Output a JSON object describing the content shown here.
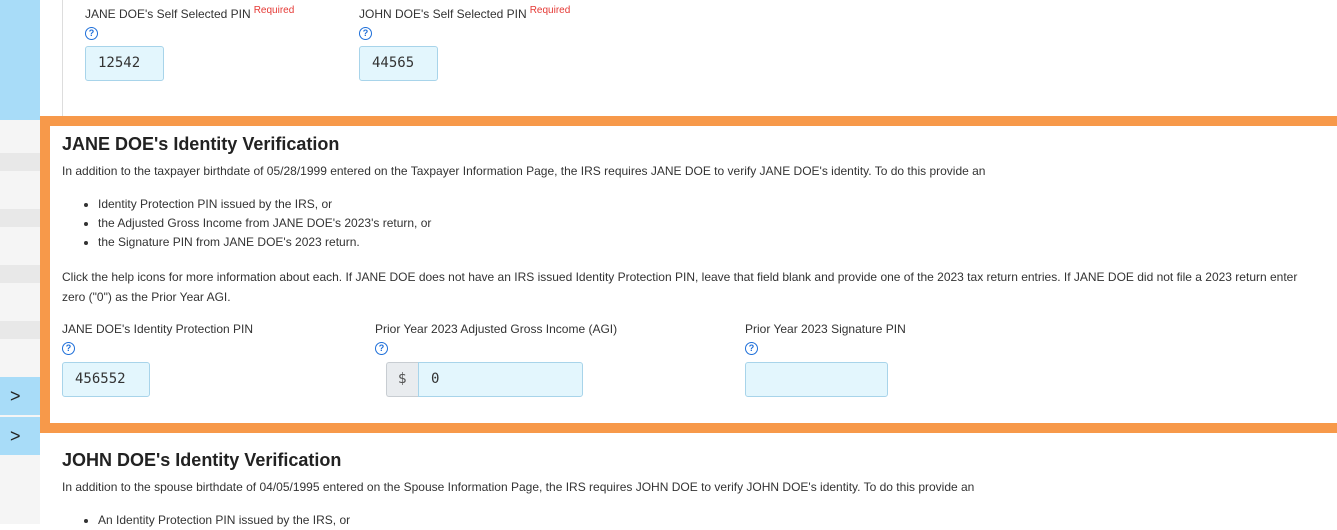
{
  "sidebar": {
    "chevron_1": ">",
    "chevron_2": ">"
  },
  "top_section": {
    "jane_pin_label": "JANE DOE's Self Selected PIN",
    "jane_pin_required": "Required",
    "jane_pin_value": "12542",
    "john_pin_label": "JOHN DOE's Self Selected PIN",
    "john_pin_required": "Required",
    "john_pin_value": "44565",
    "help_glyph": "?"
  },
  "jane_verification": {
    "title": "JANE DOE's Identity Verification",
    "intro": "In addition to the taxpayer birthdate of 05/28/1999 entered on the Taxpayer Information Page, the IRS requires JANE DOE to verify JANE DOE's identity. To do this provide an",
    "options": [
      "Identity Protection PIN issued by the IRS, or",
      "the Adjusted Gross Income from JANE DOE's 2023's return, or",
      "the Signature PIN from JANE DOE's 2023 return."
    ],
    "instructions": "Click the help icons for more information about each. If JANE DOE does not have an IRS issued Identity Protection PIN, leave that field blank and provide one of the 2023 tax return entries. If JANE DOE did not file a 2023 return enter zero (\"0\") as the Prior Year AGI.",
    "ip_pin_label": "JANE DOE's Identity Protection PIN",
    "ip_pin_value": "456552",
    "agi_label": "Prior Year 2023 Adjusted Gross Income (AGI)",
    "agi_prefix": "$",
    "agi_value": "0",
    "sig_pin_label": "Prior Year 2023 Signature PIN",
    "sig_pin_value": ""
  },
  "john_verification": {
    "title": "JOHN DOE's Identity Verification",
    "intro": "In addition to the spouse birthdate of 04/05/1995 entered on the Spouse Information Page, the IRS requires JOHN DOE to verify JOHN DOE's identity. To do this provide an",
    "options": [
      "An Identity Protection PIN issued by the IRS, or"
    ]
  },
  "colors": {
    "highlight_border": "#f7994a",
    "input_bg": "#e3f6fd",
    "sidebar_accent": "#a8dcf8",
    "required_red": "#e53935",
    "help_blue": "#1e6fd9"
  }
}
